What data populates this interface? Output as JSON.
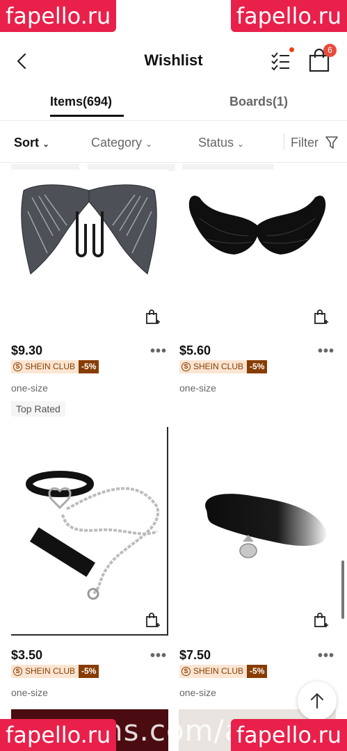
{
  "watermark": {
    "text": "fapello.ru",
    "center_text": "ns.com/au"
  },
  "header": {
    "title": "Wishlist",
    "cart_count": "6"
  },
  "tabs": [
    {
      "label": "Items(694)",
      "active": true
    },
    {
      "label": "Boards(1)",
      "active": false
    }
  ],
  "filters": {
    "sort": "Sort",
    "category": "Category",
    "status": "Status",
    "filter": "Filter"
  },
  "products": [
    {
      "image": "grey-angel-wings-image",
      "price": "$9.30",
      "club": "SHEIN CLUB",
      "discount": "-5%",
      "size": "one-size",
      "badge": "Top Rated"
    },
    {
      "image": "black-feather-wings-image",
      "price": "$5.60",
      "club": "SHEIN CLUB",
      "discount": "-5%",
      "size": "one-size",
      "badge": ""
    },
    {
      "image": "choker-leash-image",
      "price": "$3.50",
      "club": "SHEIN CLUB",
      "discount": "-5%",
      "size": "one-size",
      "badge": ""
    },
    {
      "image": "fox-tail-image",
      "price": "$7.50",
      "club": "SHEIN CLUB",
      "discount": "-5%",
      "size": "one-size",
      "badge": ""
    }
  ],
  "more_label": "•••",
  "colors": {
    "accent": "#873c00",
    "club_bg": "#fbe5d2",
    "badge": "#e64b3c",
    "watermark": "#e8204a"
  }
}
